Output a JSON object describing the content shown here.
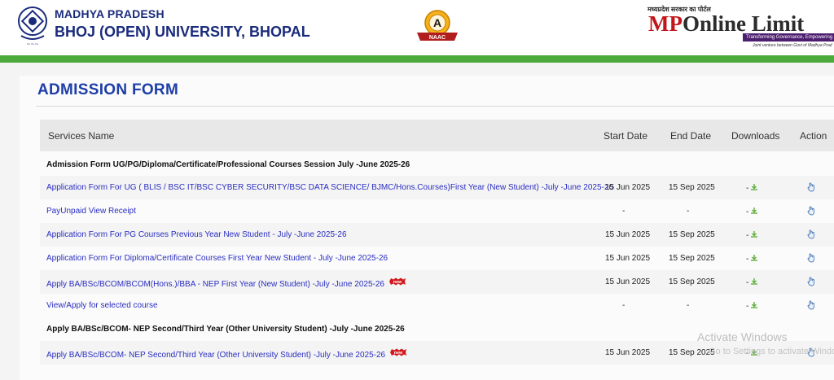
{
  "header": {
    "uni_line1": "MADHYA PRADESH",
    "uni_line2": "BHOJ (OPEN) UNIVERSITY, BHOPAL",
    "naac_grade": "A",
    "naac_label": "NAAC",
    "mp_hindi": "मध्यप्रदेश सरकार का पोर्टल",
    "mp_brand_left": "MP",
    "mp_brand_o": "O",
    "mp_brand_right": "nline Limit",
    "mp_tagline": "Transforming Governance, Empowering",
    "mp_joint": "Joint venture between Govt of Madhya Prad"
  },
  "page": {
    "title": "ADMISSION FORM"
  },
  "table": {
    "columns": [
      "Services Name",
      "Start Date",
      "End Date",
      "Downloads",
      "Action"
    ],
    "group1": "Admission Form UG/PG/Diploma/Certificate/Professional Courses Session July -June 2025-26",
    "group2": "Apply BA/BSc/BCOM- NEP Second/Third Year (Other University Student) -July -June 2025-26",
    "rows": [
      {
        "name": "Application Form For UG ( BLIS / BSC IT/BSC CYBER SECURITY/BSC DATA SCIENCE/ BJMC/Hons.Courses)First Year (New Student) -July -June 2025-26",
        "start": "15 Jun 2025",
        "end": "15 Sep 2025",
        "download": "-"
      },
      {
        "name": "PayUnpaid View Receipt",
        "start": "-",
        "end": "-",
        "download": "-"
      },
      {
        "name": "Application Form For PG Courses Previous Year New Student - July -June 2025-26",
        "start": "15 Jun 2025",
        "end": "15 Sep 2025",
        "download": "-"
      },
      {
        "name": "Application Form For Diploma/Certificate Courses First Year New Student - July -June 2025-26",
        "start": "15 Jun 2025",
        "end": "15 Sep 2025",
        "download": "-"
      },
      {
        "name": "Apply BA/BSc/BCOM/BCOM(Hons.)/BBA - NEP First Year (New Student) -July -June 2025-26",
        "start": "15 Jun 2025",
        "end": "15 Sep 2025",
        "download": "-",
        "badge": "new"
      },
      {
        "name": "View/Apply for selected course",
        "start": "-",
        "end": "-",
        "download": "-"
      },
      {
        "name": "Apply BA/BSc/BCOM- NEP Second/Third Year (Other University Student) -July -June 2025-26",
        "start": "15 Jun 2025",
        "end": "15 Sep 2025",
        "download": "-",
        "badge": "new"
      }
    ]
  },
  "watermark": {
    "line1": "Activate Windows",
    "line2": "Go to Settings to activate Windows."
  },
  "colors": {
    "brand_blue": "#1a2b7c",
    "link": "#2a2ec0",
    "green_bar": "#4caa3d",
    "mp_red": "#c2161b"
  }
}
